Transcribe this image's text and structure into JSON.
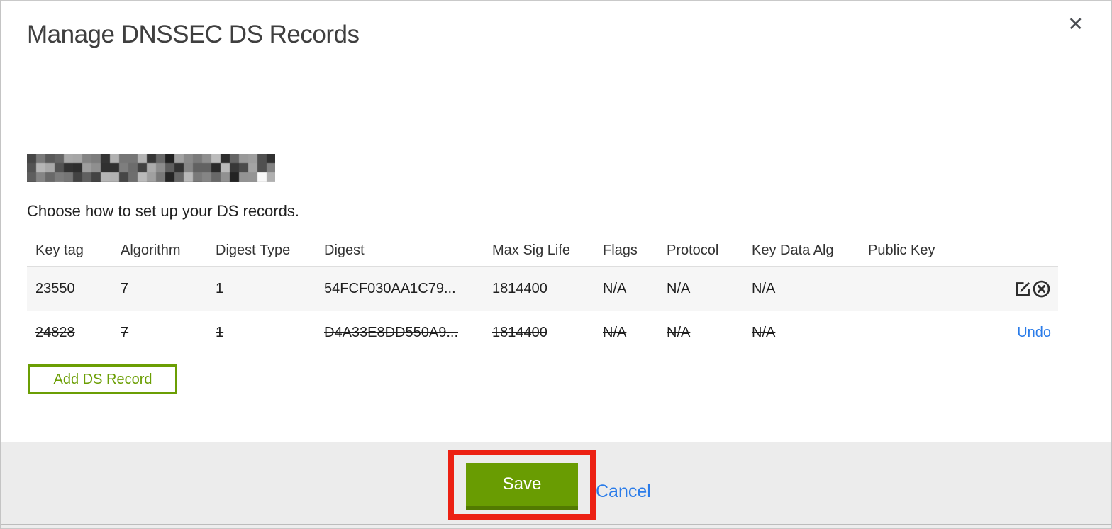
{
  "modal": {
    "title": "Manage DNSSEC DS Records",
    "subtitle": "Choose how to set up your DS records.",
    "domain_note": "domain name redacted (pixelated)"
  },
  "icons": {
    "close_glyph": "✕",
    "edit": "edit-square-pencil-icon",
    "delete": "circle-x-icon"
  },
  "table": {
    "columns": [
      "Key tag",
      "Algorithm",
      "Digest Type",
      "Digest",
      "Max Sig Life",
      "Flags",
      "Protocol",
      "Key Data Alg",
      "Public Key"
    ],
    "rows": [
      {
        "cells": [
          "23550",
          "7",
          "1",
          "54FCF030AA1C79...",
          "1814400",
          "N/A",
          "N/A",
          "N/A",
          ""
        ],
        "struck": false,
        "actions": [
          "edit",
          "delete"
        ]
      },
      {
        "cells": [
          "24828",
          "7",
          "1",
          "D4A33E8DD550A9...",
          "1814400",
          "N/A",
          "N/A",
          "N/A",
          ""
        ],
        "struck": true,
        "action_label": "Undo"
      }
    ]
  },
  "buttons": {
    "add_ds_record": "Add DS Record",
    "save": "Save",
    "cancel": "Cancel"
  },
  "colors": {
    "green": "#699c02",
    "green_dark": "#527a01",
    "green_outline": "#6b9e04",
    "link_blue": "#2b7ce9",
    "annotation_red": "#ec2113",
    "row_gray": "#f6f6f6",
    "footer_gray": "#ececec"
  }
}
